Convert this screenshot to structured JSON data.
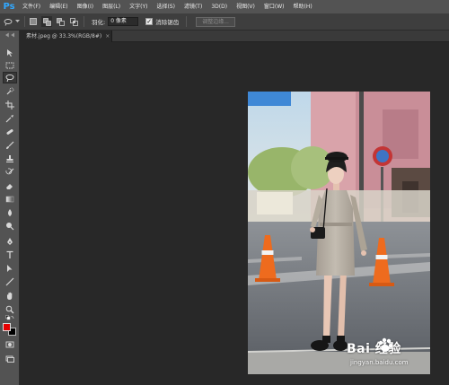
{
  "app": {
    "logo": "Ps"
  },
  "menu": [
    "文件(F)",
    "编辑(E)",
    "图像(I)",
    "图层(L)",
    "文字(Y)",
    "选择(S)",
    "滤镜(T)",
    "3D(D)",
    "视图(V)",
    "窗口(W)",
    "帮助(H)"
  ],
  "options_bar": {
    "feather_label": "羽化:",
    "feather_value": "0 像素",
    "antialias_label": "消除锯齿",
    "antialias_checked": true,
    "refine_edge_label": "调整边缘..."
  },
  "document": {
    "tab_title": "素材.jpeg @ 33.3%(RGB/8#)",
    "close_symbol": "×"
  },
  "toolbar": {
    "active_tool": "lasso-tool",
    "foreground_color": "#e60000",
    "background_color": "#000000"
  },
  "watermark": {
    "brand": "Bai 经验",
    "url": "jingyan.baidu.com"
  }
}
